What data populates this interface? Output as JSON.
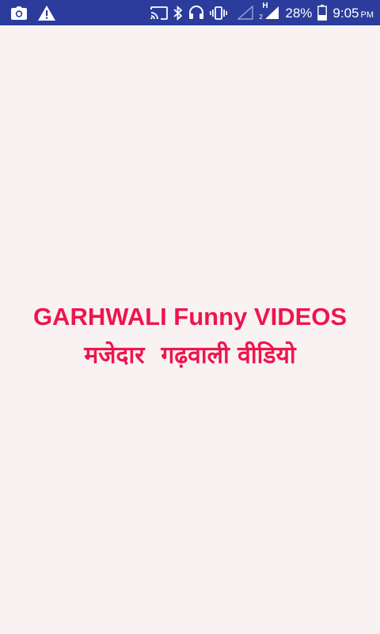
{
  "status_bar": {
    "background": "#2c3c9c",
    "icons_left": [
      "camera-icon",
      "warning-icon"
    ],
    "icons_right": [
      "cast-icon",
      "bluetooth-icon",
      "headset-icon",
      "vibrate-icon",
      "wifi-off-icon",
      "signal-icon"
    ],
    "network_type": "H",
    "sim_slot": "2",
    "battery": "28%",
    "time": "9:05",
    "ampm": "PM"
  },
  "splash": {
    "title_en": "GARHWALI Funny VIDEOS",
    "title_hi": "मजेदार  गढ़वाली वीडियो",
    "text_color": "#f0144e",
    "background": "#f8f3f2"
  }
}
